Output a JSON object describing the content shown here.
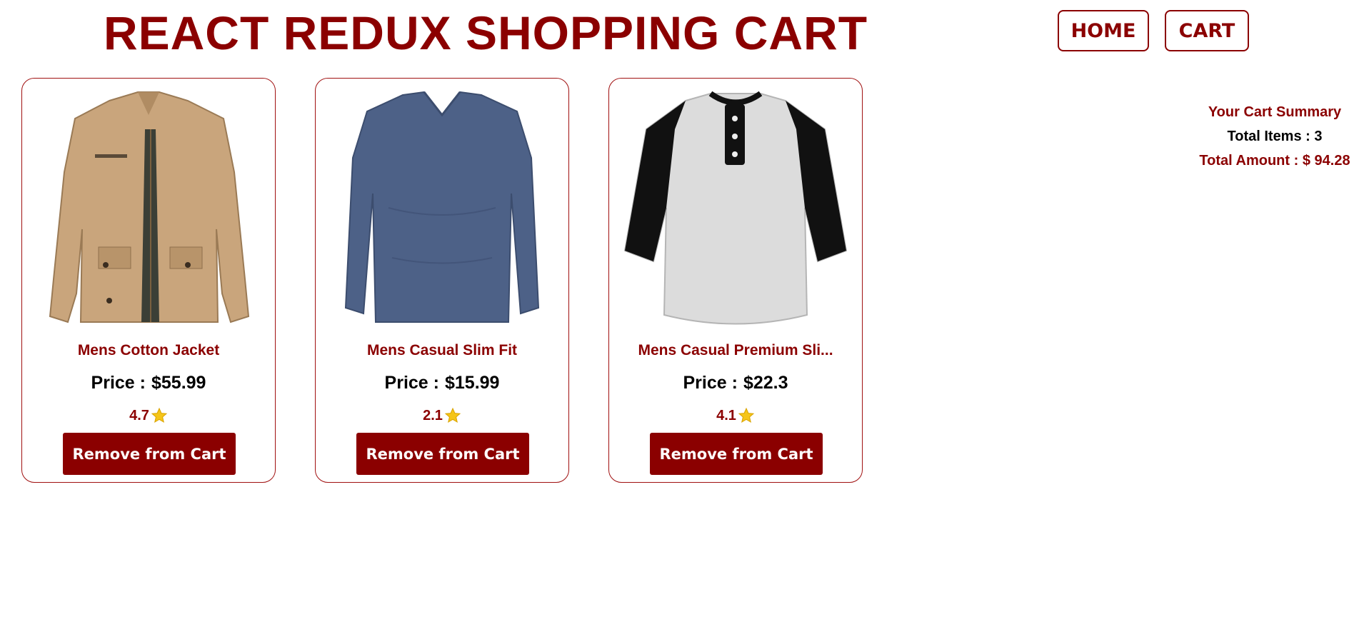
{
  "header": {
    "title": "REACT REDUX SHOPPING CART",
    "nav": {
      "home_label": "HOME",
      "cart_label": "CART"
    }
  },
  "products": [
    {
      "title": "Mens Cotton Jacket",
      "price_label": "Price :",
      "price": "$55.99",
      "rating": "4.7",
      "button_label": "Remove from Cart",
      "image": "cotton-jacket-image"
    },
    {
      "title": "Mens Casual Slim Fit",
      "price_label": "Price :",
      "price": "$15.99",
      "rating": "2.1",
      "button_label": "Remove from Cart",
      "image": "blue-longsleeve-tshirt-image"
    },
    {
      "title": "Mens Casual Premium Sli...",
      "price_label": "Price :",
      "price": "$22.3",
      "rating": "4.1",
      "button_label": "Remove from Cart",
      "image": "raglan-henley-shirt-image"
    }
  ],
  "summary": {
    "title": "Your Cart Summary",
    "total_items": "Total Items : 3",
    "total_amount": "Total Amount : $ 94.28"
  },
  "colors": {
    "accent": "#8b0000",
    "star": "#f5c518"
  }
}
